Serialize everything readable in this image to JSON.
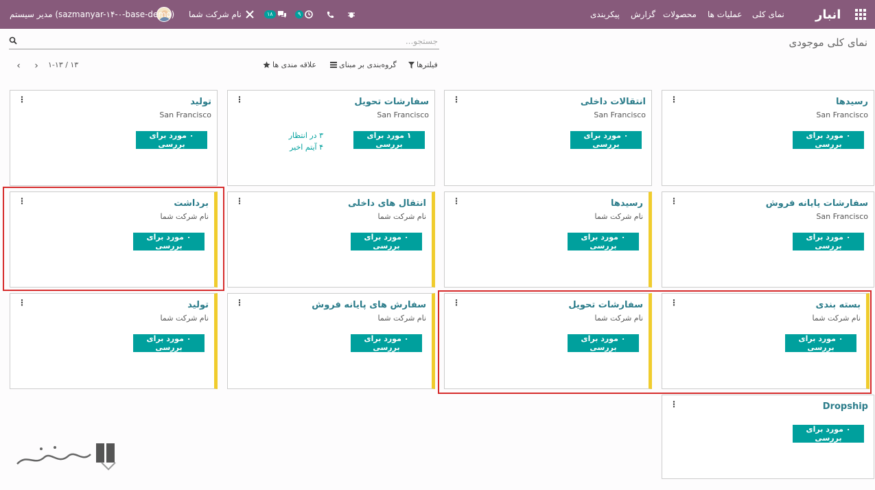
{
  "topbar": {
    "brand": "انبار",
    "menu": [
      "نمای کلی",
      "عملیات ها",
      "محصولات",
      "گزارش",
      "پیکربندی"
    ],
    "company": "نام شرکت شما",
    "user": "مدیر سیستم (sazmanyar-۱۴-۰-base-demo)",
    "badge_activity": "۹",
    "badge_messages": "۱۸",
    "icons": [
      "apps-icon",
      "bug-icon",
      "phone-icon",
      "clock-icon",
      "chat-icon",
      "tools-icon"
    ]
  },
  "page": {
    "title": "نمای کلی موجودی",
    "search_placeholder": "جستجو...",
    "filters_label": "فیلترها",
    "groupby_label": "گروه‌بندی بر مبنای",
    "favorites_label": "علاقه مندی ها",
    "pager": "۱-۱۳ / ۱۳"
  },
  "cards": [
    {
      "name": "رسیدها",
      "sub": "San Francisco",
      "button": "۰ مورد برای بررسی",
      "stripe": false
    },
    {
      "name": "انتقالات داخلی",
      "sub": "San Francisco",
      "button": "۰ مورد برای بررسی",
      "stripe": false
    },
    {
      "name": "سفارشات تحویل",
      "sub": "San Francisco",
      "button": "۱ مورد برای بررسی",
      "stripe": false,
      "stats": [
        "۳ در انتظار",
        "۴ آیتم اخیر"
      ]
    },
    {
      "name": "تولید",
      "sub": "San Francisco",
      "button": "۰ مورد برای بررسی",
      "stripe": false
    },
    {
      "name": "سفارشات پایانه فروش",
      "sub": "San Francisco",
      "button": "۰ مورد برای بررسی",
      "stripe": false
    },
    {
      "name": "رسیدها",
      "sub": "نام شرکت شما",
      "button": "۰ مورد برای بررسی",
      "stripe": true
    },
    {
      "name": "انتقال های داخلی",
      "sub": "نام شرکت شما",
      "button": "۰ مورد برای بررسی",
      "stripe": true
    },
    {
      "name": "برداشت",
      "sub": "نام شرکت شما",
      "button": "۰ مورد برای بررسی",
      "stripe": true
    },
    {
      "name": "بسته بندی",
      "sub": "نام شرکت شما",
      "button": "۰ مورد برای بررسی",
      "stripe": true
    },
    {
      "name": "سفارشات تحویل",
      "sub": "نام شرکت شما",
      "button": "۰ مورد برای بررسی",
      "stripe": true
    },
    {
      "name": "سفارش های پایانه فروش",
      "sub": "نام شرکت شما",
      "button": "۰ مورد برای بررسی",
      "stripe": true
    },
    {
      "name": "تولید",
      "sub": "نام شرکت شما",
      "button": "۰ مورد برای بررسی",
      "stripe": true
    },
    {
      "name": "Dropship",
      "sub": "",
      "button": "۰ مورد برای بررسی",
      "stripe": false
    }
  ],
  "colors": {
    "topbar": "#875a7b",
    "accent": "#00a09d",
    "stripe": "#f0cc2d",
    "highlight": "#d62b2b",
    "link": "#2b7c8a"
  }
}
